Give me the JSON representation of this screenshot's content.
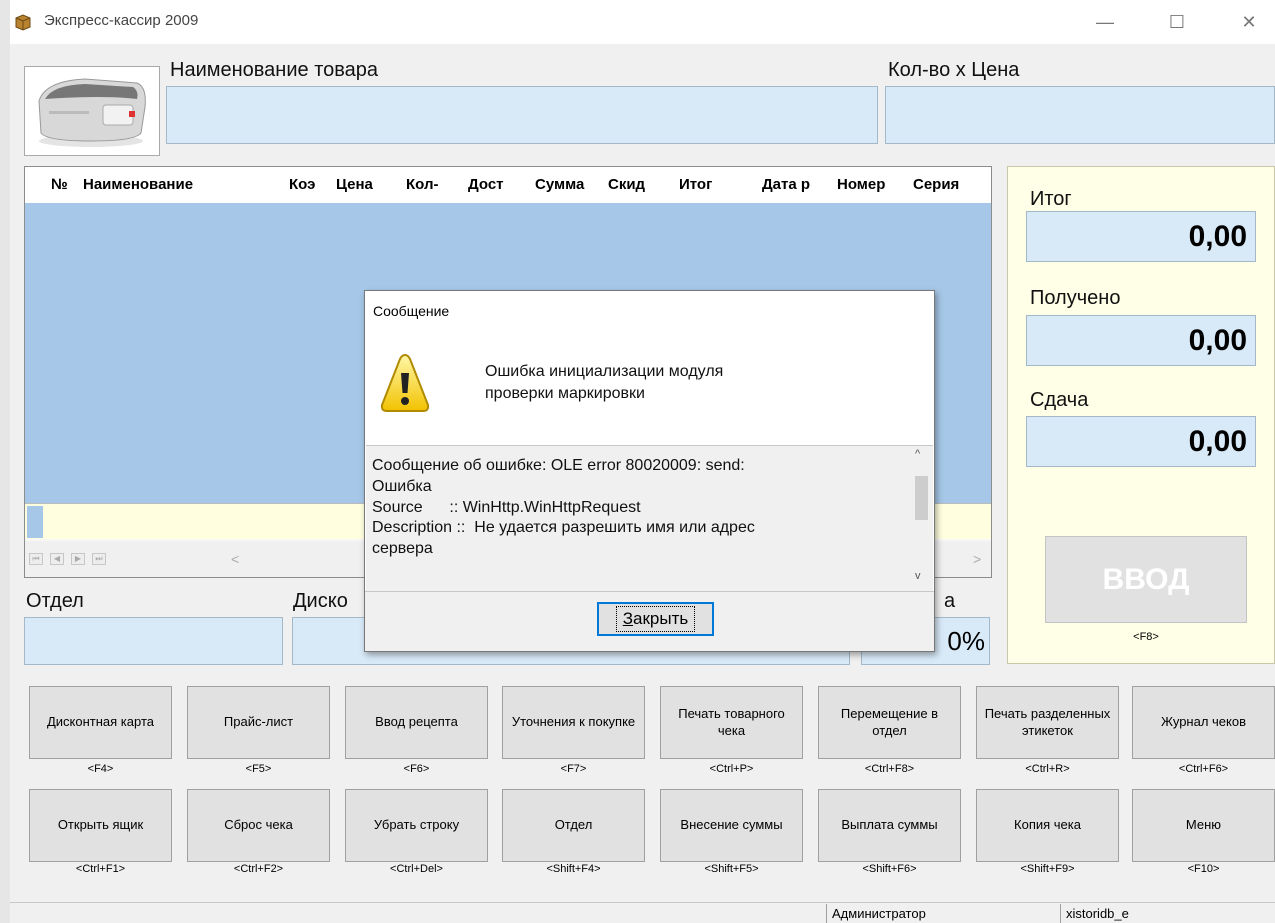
{
  "window": {
    "title": "Экспресс-кассир 2009",
    "min_glyph": "—",
    "max_glyph": "☐",
    "close_glyph": "✕"
  },
  "top": {
    "name_label": "Наименование товара",
    "qty_label": "Кол-во х Цена",
    "printer_icon": "receipt-printer-icon"
  },
  "grid": {
    "columns": [
      "№",
      "Наименование",
      "Коэ",
      "Цена",
      "Кол-",
      "Дост",
      "Сумма",
      "Скид",
      "Итог",
      "Дата р",
      "Номер",
      "Серия"
    ],
    "nav": [
      "⏮",
      "◀",
      "▶",
      "⏭"
    ],
    "scroll_left": "<",
    "scroll_right": ">"
  },
  "totals": {
    "itog_label": "Итог",
    "itog_value": "0,00",
    "received_label": "Получено",
    "received_value": "0,00",
    "change_label": "Сдача",
    "change_value": "0,00",
    "vvod_label": "ВВОД",
    "vvod_shortcut": "<F8>"
  },
  "fields": {
    "dept_label": "Отдел",
    "discount_label": "Диско",
    "tail_label": "а",
    "percent_value": "0%"
  },
  "buttons_row1": [
    {
      "label": "Дисконтная карта",
      "shortcut": "<F4>"
    },
    {
      "label": "Прайс-лист",
      "shortcut": "<F5>"
    },
    {
      "label": "Ввод рецепта",
      "shortcut": "<F6>"
    },
    {
      "label": "Уточнения к покупке",
      "shortcut": "<F7>"
    },
    {
      "label": "Печать товарного чека",
      "shortcut": "<Ctrl+P>"
    },
    {
      "label": "Перемещение в отдел",
      "shortcut": "<Ctrl+F8>"
    },
    {
      "label": "Печать разделенных этикеток",
      "shortcut": "<Ctrl+R>"
    },
    {
      "label": "Журнал чеков",
      "shortcut": "<Ctrl+F6>"
    }
  ],
  "buttons_row2": [
    {
      "label": "Открыть ящик",
      "shortcut": "<Ctrl+F1>"
    },
    {
      "label": "Сброс чека",
      "shortcut": "<Ctrl+F2>"
    },
    {
      "label": "Убрать строку",
      "shortcut": "<Ctrl+Del>"
    },
    {
      "label": "Отдел",
      "shortcut": "<Shift+F4>"
    },
    {
      "label": "Внесение суммы",
      "shortcut": "<Shift+F5>"
    },
    {
      "label": "Выплата суммы",
      "shortcut": "<Shift+F6>"
    },
    {
      "label": "Копия чека",
      "shortcut": "<Shift+F9>"
    },
    {
      "label": "Меню",
      "shortcut": "<F10>"
    }
  ],
  "status": {
    "user": "Администратор",
    "db": "xistoridb_e"
  },
  "dialog": {
    "title": "Сообщение",
    "icon": "warning-icon",
    "message_line1": "Ошибка инициализации модуля",
    "message_line2": "проверки маркировки",
    "details": "Сообщение об ошибке: OLE error 80020009: send:\nОшибка\nSource      :: WinHttp.WinHttpRequest\nDescription ::  Не удается разрешить имя или адрес\nсервера",
    "close_hotkey": "З",
    "close_rest": "акрыть"
  },
  "colors": {
    "grid_body": "#a6c7e8",
    "field_bg": "#d8e9f7",
    "totals_bg": "#ffffe8",
    "focus_border": "#0078d7"
  }
}
